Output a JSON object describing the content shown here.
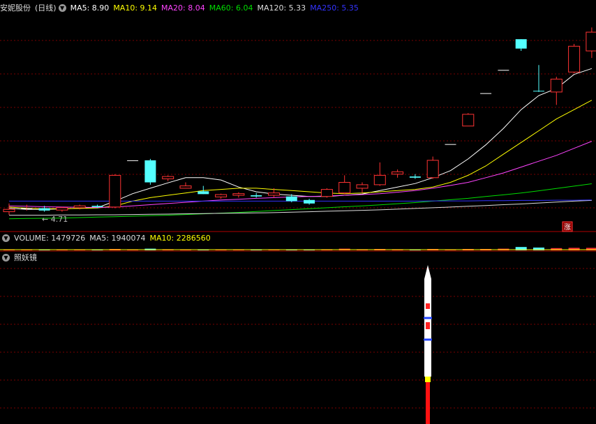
{
  "price_panel": {
    "stock_name": "安妮股份",
    "period": "(日线)",
    "indicators": [
      {
        "label": "MA5: ",
        "value": "8.90",
        "color": "#ffffff"
      },
      {
        "label": "MA10: ",
        "value": "9.14",
        "color": "#ffff00"
      },
      {
        "label": "MA20: ",
        "value": "8.04",
        "color": "#ff44ff"
      },
      {
        "label": "MA60: ",
        "value": "6.04",
        "color": "#00dd00"
      },
      {
        "label": "MA120: ",
        "value": "5.33",
        "color": "#dddddd"
      },
      {
        "label": "MA250: ",
        "value": "5.35",
        "color": "#3333ff"
      }
    ],
    "low_marker": "4.71",
    "badge": "涨"
  },
  "volume_panel": {
    "indicators": [
      {
        "label": "VOLUME: ",
        "value": "1479726",
        "color": "#dddddd"
      },
      {
        "label": "MA5: ",
        "value": "1940074",
        "color": "#dddddd"
      },
      {
        "label": "MA10: ",
        "value": "2286560",
        "color": "#ffff00"
      }
    ]
  },
  "indicator_panel": {
    "title": "照妖镜"
  },
  "chart_data": {
    "type": "candlestick",
    "colors": {
      "up": "#ff3333",
      "down": "#54ffff",
      "grid": "#7a0000",
      "background": "#000000"
    },
    "candles": [
      {
        "o": 4.85,
        "h": 5.2,
        "l": 4.72,
        "c": 4.95
      },
      {
        "o": 4.98,
        "h": 5.15,
        "l": 4.9,
        "c": 5.0
      },
      {
        "o": 5.0,
        "h": 5.1,
        "l": 4.85,
        "c": 4.9
      },
      {
        "o": 4.92,
        "h": 5.05,
        "l": 4.85,
        "c": 5.02
      },
      {
        "o": 5.02,
        "h": 5.15,
        "l": 4.95,
        "c": 5.1
      },
      {
        "o": 5.1,
        "h": 5.15,
        "l": 5.0,
        "c": 5.05
      },
      {
        "o": 5.05,
        "h": 6.45,
        "l": 5.0,
        "c": 6.4
      },
      {
        "o": 7.04,
        "h": 7.04,
        "l": 7.04,
        "c": 7.04
      },
      {
        "o": 7.04,
        "h": 7.1,
        "l": 6.0,
        "c": 6.1
      },
      {
        "o": 6.25,
        "h": 6.4,
        "l": 6.15,
        "c": 6.35
      },
      {
        "o": 5.85,
        "h": 6.1,
        "l": 5.85,
        "c": 5.95
      },
      {
        "o": 5.72,
        "h": 5.95,
        "l": 5.6,
        "c": 5.6
      },
      {
        "o": 5.48,
        "h": 5.62,
        "l": 5.4,
        "c": 5.58
      },
      {
        "o": 5.55,
        "h": 5.68,
        "l": 5.45,
        "c": 5.62
      },
      {
        "o": 5.55,
        "h": 5.65,
        "l": 5.45,
        "c": 5.5
      },
      {
        "o": 5.55,
        "h": 5.85,
        "l": 5.45,
        "c": 5.65
      },
      {
        "o": 5.5,
        "h": 5.6,
        "l": 5.25,
        "c": 5.3
      },
      {
        "o": 5.35,
        "h": 5.4,
        "l": 5.15,
        "c": 5.2
      },
      {
        "o": 5.5,
        "h": 5.85,
        "l": 5.45,
        "c": 5.8
      },
      {
        "o": 5.65,
        "h": 6.4,
        "l": 5.6,
        "c": 6.1
      },
      {
        "o": 5.85,
        "h": 6.1,
        "l": 5.65,
        "c": 6.0
      },
      {
        "o": 6.0,
        "h": 6.95,
        "l": 5.95,
        "c": 6.4
      },
      {
        "o": 6.45,
        "h": 6.65,
        "l": 6.3,
        "c": 6.55
      },
      {
        "o": 6.35,
        "h": 6.45,
        "l": 6.25,
        "c": 6.3
      },
      {
        "o": 6.3,
        "h": 7.2,
        "l": 6.25,
        "c": 7.04
      },
      {
        "o": 7.73,
        "h": 7.73,
        "l": 7.73,
        "c": 7.73
      },
      {
        "o": 8.5,
        "h": 9.05,
        "l": 8.5,
        "c": 9.0
      },
      {
        "o": 9.9,
        "h": 9.9,
        "l": 9.9,
        "c": 9.9
      },
      {
        "o": 10.89,
        "h": 10.89,
        "l": 10.89,
        "c": 10.89
      },
      {
        "o": 12.2,
        "h": 12.2,
        "l": 11.7,
        "c": 11.8
      },
      {
        "o": 10.0,
        "h": 11.1,
        "l": 9.95,
        "c": 9.98
      },
      {
        "o": 9.95,
        "h": 10.6,
        "l": 9.4,
        "c": 10.5
      },
      {
        "o": 10.8,
        "h": 12.0,
        "l": 10.75,
        "c": 11.9
      },
      {
        "o": 11.7,
        "h": 12.7,
        "l": 11.4,
        "c": 12.5
      }
    ],
    "ma_series": [
      {
        "name": "MA5",
        "color": "#ffffff",
        "values": [
          5.0,
          4.95,
          4.95,
          4.97,
          5.0,
          5.02,
          5.3,
          5.62,
          5.85,
          6.08,
          6.3,
          6.3,
          6.2,
          5.9,
          5.7,
          5.6,
          5.55,
          5.5,
          5.5,
          5.55,
          5.6,
          5.75,
          5.9,
          6.05,
          6.3,
          6.6,
          7.1,
          7.7,
          8.4,
          9.2,
          9.8,
          10.1,
          10.7,
          10.95
        ]
      },
      {
        "name": "MA10",
        "color": "#ffff00",
        "values": [
          5.05,
          5.0,
          4.98,
          4.98,
          4.99,
          5.01,
          5.1,
          5.3,
          5.45,
          5.55,
          5.65,
          5.75,
          5.8,
          5.85,
          5.85,
          5.8,
          5.75,
          5.7,
          5.65,
          5.62,
          5.65,
          5.7,
          5.75,
          5.8,
          5.9,
          6.1,
          6.4,
          6.8,
          7.3,
          7.8,
          8.3,
          8.8,
          9.2,
          9.6
        ]
      },
      {
        "name": "MA20",
        "color": "#ff44ff",
        "values": [
          5.1,
          5.08,
          5.06,
          5.05,
          5.04,
          5.03,
          5.05,
          5.1,
          5.15,
          5.2,
          5.25,
          5.3,
          5.35,
          5.38,
          5.42,
          5.45,
          5.48,
          5.5,
          5.52,
          5.55,
          5.58,
          5.62,
          5.68,
          5.75,
          5.85,
          5.97,
          6.1,
          6.3,
          6.5,
          6.75,
          7.0,
          7.25,
          7.55,
          7.85
        ]
      },
      {
        "name": "MA60",
        "color": "#00dd00",
        "values": [
          4.55,
          4.56,
          4.57,
          4.58,
          4.6,
          4.62,
          4.64,
          4.66,
          4.68,
          4.7,
          4.73,
          4.76,
          4.79,
          4.82,
          4.86,
          4.9,
          4.94,
          4.98,
          5.02,
          5.06,
          5.1,
          5.14,
          5.19,
          5.24,
          5.3,
          5.36,
          5.42,
          5.5,
          5.57,
          5.65,
          5.74,
          5.84,
          5.94,
          6.04
        ]
      },
      {
        "name": "MA120",
        "color": "#dddddd",
        "values": [
          4.7,
          4.7,
          4.7,
          4.71,
          4.71,
          4.72,
          4.72,
          4.73,
          4.74,
          4.75,
          4.76,
          4.77,
          4.78,
          4.79,
          4.8,
          4.81,
          4.83,
          4.85,
          4.87,
          4.89,
          4.91,
          4.93,
          4.96,
          4.99,
          5.02,
          5.05,
          5.08,
          5.11,
          5.15,
          5.18,
          5.22,
          5.26,
          5.3,
          5.33
        ]
      },
      {
        "name": "MA250",
        "color": "#3333ff",
        "values": [
          5.3,
          5.3,
          5.3,
          5.3,
          5.3,
          5.3,
          5.3,
          5.3,
          5.3,
          5.3,
          5.3,
          5.3,
          5.3,
          5.3,
          5.3,
          5.3,
          5.3,
          5.3,
          5.3,
          5.3,
          5.3,
          5.3,
          5.3,
          5.3,
          5.31,
          5.31,
          5.31,
          5.32,
          5.32,
          5.33,
          5.33,
          5.34,
          5.34,
          5.35
        ]
      }
    ],
    "volume": [
      0.3,
      0.3,
      0.2,
      0.2,
      0.3,
      0.2,
      0.5,
      0.2,
      0.6,
      0.4,
      0.3,
      0.3,
      0.2,
      0.3,
      0.2,
      0.3,
      0.3,
      0.3,
      0.4,
      0.6,
      0.4,
      0.5,
      0.4,
      0.3,
      0.5,
      0.3,
      0.5,
      0.5,
      0.6,
      1.2,
      1.0,
      0.8,
      0.9,
      0.9
    ]
  }
}
